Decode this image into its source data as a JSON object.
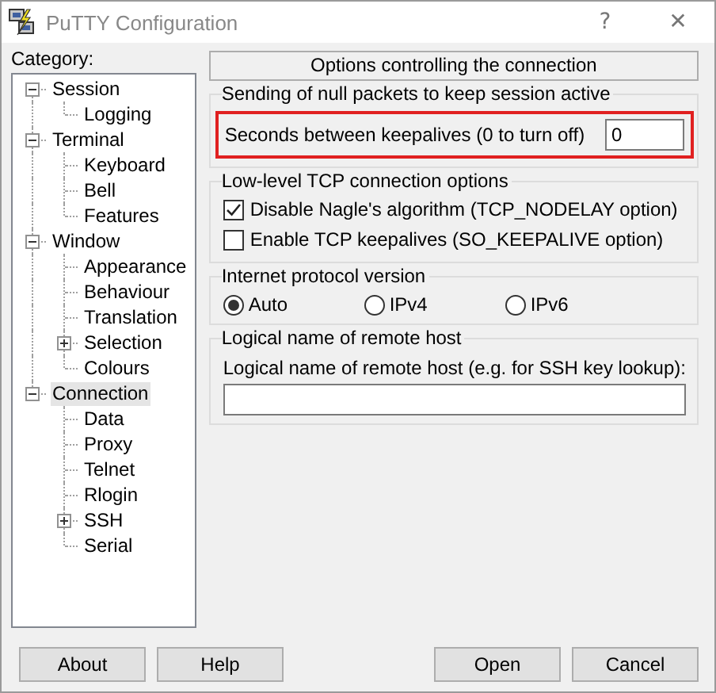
{
  "window": {
    "title": "PuTTY Configuration",
    "help_glyph": "?",
    "close_glyph": "✕"
  },
  "category": {
    "label": "Category:",
    "tree": [
      {
        "label": "Session",
        "selected": false,
        "expanded": true,
        "children": [
          {
            "label": "Logging",
            "selected": false
          }
        ]
      },
      {
        "label": "Terminal",
        "selected": false,
        "expanded": true,
        "children": [
          {
            "label": "Keyboard",
            "selected": false
          },
          {
            "label": "Bell",
            "selected": false
          },
          {
            "label": "Features",
            "selected": false
          }
        ]
      },
      {
        "label": "Window",
        "selected": false,
        "expanded": true,
        "children": [
          {
            "label": "Appearance",
            "selected": false
          },
          {
            "label": "Behaviour",
            "selected": false
          },
          {
            "label": "Translation",
            "selected": false
          },
          {
            "label": "Selection",
            "selected": false,
            "expanded": false
          },
          {
            "label": "Colours",
            "selected": false
          }
        ]
      },
      {
        "label": "Connection",
        "selected": true,
        "expanded": true,
        "children": [
          {
            "label": "Data",
            "selected": false
          },
          {
            "label": "Proxy",
            "selected": false
          },
          {
            "label": "Telnet",
            "selected": false
          },
          {
            "label": "Rlogin",
            "selected": false
          },
          {
            "label": "SSH",
            "selected": false,
            "expanded": false
          },
          {
            "label": "Serial",
            "selected": false
          }
        ]
      }
    ]
  },
  "panel": {
    "header": "Options controlling the connection",
    "keepalive": {
      "legend": "Sending of null packets to keep session active",
      "label": "Seconds between keepalives (0 to turn off)",
      "value": "0",
      "highlighted": true
    },
    "tcp": {
      "legend": "Low-level TCP connection options",
      "options": [
        {
          "label": "Disable Nagle's algorithm (TCP_NODELAY option)",
          "checked": true
        },
        {
          "label": "Enable TCP keepalives (SO_KEEPALIVE option)",
          "checked": false
        }
      ]
    },
    "protocol": {
      "legend": "Internet protocol version",
      "options": [
        {
          "label": "Auto",
          "selected": true
        },
        {
          "label": "IPv4",
          "selected": false
        },
        {
          "label": "IPv6",
          "selected": false
        }
      ]
    },
    "remote_host": {
      "legend": "Logical name of remote host",
      "label": "Logical name of remote host (e.g. for SSH key lookup):"
    }
  },
  "buttons": {
    "left": [
      "About",
      "Help"
    ],
    "right": [
      "Open",
      "Cancel"
    ]
  }
}
